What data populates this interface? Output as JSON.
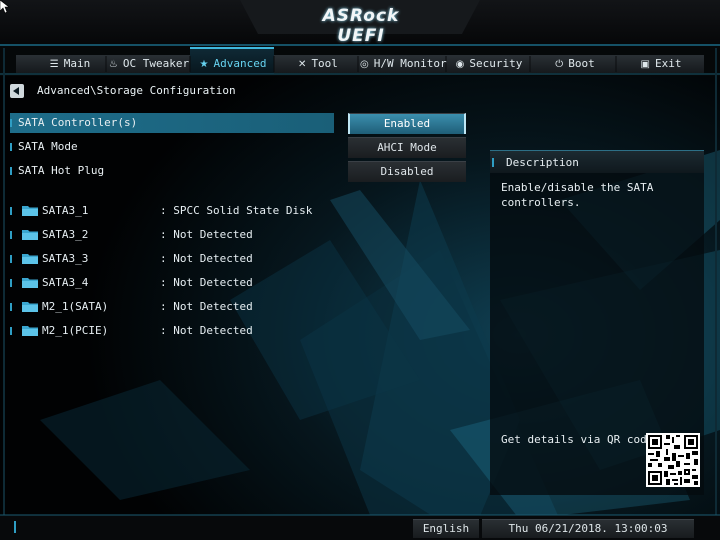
{
  "header": {
    "brand": "ASRock UEFI"
  },
  "tabs": [
    {
      "label": "Main",
      "icon": "list-icon",
      "glyph": "☰",
      "active": false
    },
    {
      "label": "OC Tweaker",
      "icon": "flame-icon",
      "glyph": "♨",
      "active": false
    },
    {
      "label": "Advanced",
      "icon": "star-icon",
      "glyph": "★",
      "active": true
    },
    {
      "label": "Tool",
      "icon": "tools-icon",
      "glyph": "✕",
      "active": false
    },
    {
      "label": "H/W Monitor",
      "icon": "monitor-icon",
      "glyph": "◎",
      "active": false
    },
    {
      "label": "Security",
      "icon": "shield-icon",
      "glyph": "◉",
      "active": false
    },
    {
      "label": "Boot",
      "icon": "power-icon",
      "glyph": "⏻",
      "active": false
    },
    {
      "label": "Exit",
      "icon": "exit-icon",
      "glyph": "▣",
      "active": false
    }
  ],
  "breadcrumb": "Advanced\\Storage Configuration",
  "settings": [
    {
      "label": "SATA Controller(s)",
      "value": "Enabled",
      "selected": true
    },
    {
      "label": "SATA Mode",
      "value": "AHCI Mode",
      "selected": false
    },
    {
      "label": "SATA Hot Plug",
      "value": "Disabled",
      "selected": false
    }
  ],
  "devices": [
    {
      "name": "SATA3_1",
      "status": ": SPCC Solid State Disk"
    },
    {
      "name": "SATA3_2",
      "status": ": Not Detected"
    },
    {
      "name": "SATA3_3",
      "status": ": Not Detected"
    },
    {
      "name": "SATA3_4",
      "status": ": Not Detected"
    },
    {
      "name": "M2_1(SATA)",
      "status": ": Not Detected"
    },
    {
      "name": "M2_1(PCIE)",
      "status": ": Not Detected"
    }
  ],
  "description": {
    "title": "Description",
    "text": "Enable/disable the SATA controllers.",
    "qr_label": "Get details via QR code"
  },
  "footer": {
    "language": "English",
    "datetime": "Thu 06/21/2018. 13:00:03"
  },
  "colors": {
    "accent": "#2f9ec4",
    "selected_row": "#1e6d8a",
    "active_tab_text": "#66d2ef"
  }
}
